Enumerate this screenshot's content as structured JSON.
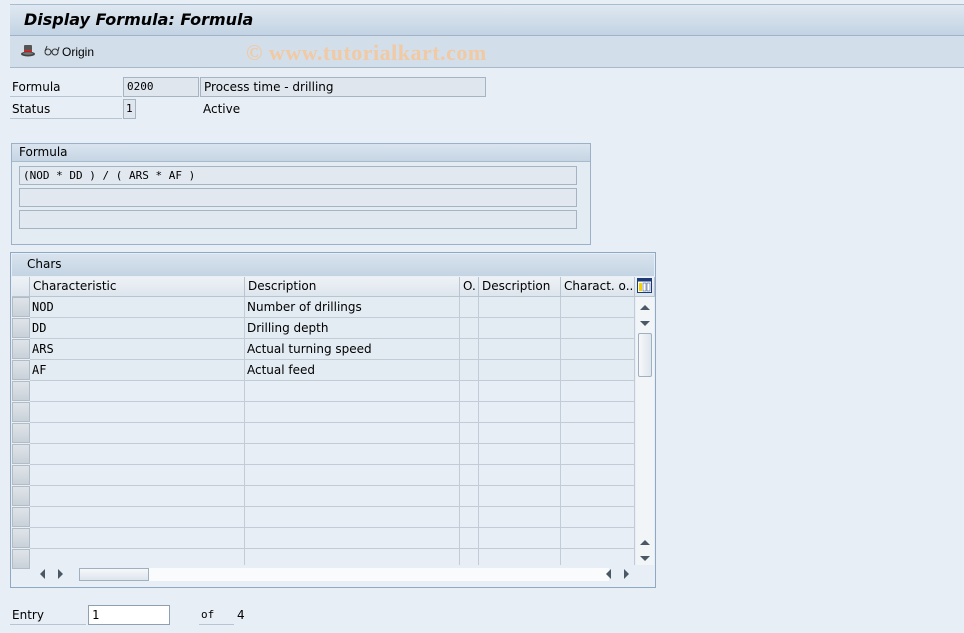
{
  "window": {
    "title": "Display Formula: Formula"
  },
  "toolbar": {
    "save_icon": "hat-icon",
    "origin_label": "Origin",
    "origin_icon": "glasses-icon"
  },
  "watermark": "© www.tutorialkart.com",
  "header": {
    "formula_label": "Formula",
    "formula_id": "0200",
    "formula_desc": "Process time - drilling",
    "status_label": "Status",
    "status_value": "1",
    "status_text": "Active"
  },
  "formula_group": {
    "title": "Formula",
    "lines": [
      "(NOD * DD ) / ( ARS * AF )",
      "",
      ""
    ]
  },
  "chars_table": {
    "title": "Chars",
    "columns": [
      "Characteristic",
      "Description",
      "O.",
      "Description",
      "Charact. o..."
    ],
    "rows": [
      [
        "NOD",
        "Number of drillings",
        "",
        "",
        ""
      ],
      [
        "DD",
        "Drilling depth",
        "",
        "",
        ""
      ],
      [
        "ARS",
        "Actual turning speed",
        "",
        "",
        ""
      ],
      [
        "AF",
        "Actual feed",
        "",
        "",
        ""
      ]
    ],
    "empty_rows": 9
  },
  "footer": {
    "entry_label": "Entry",
    "entry_value": "1",
    "of_label": "of",
    "total": "4"
  }
}
